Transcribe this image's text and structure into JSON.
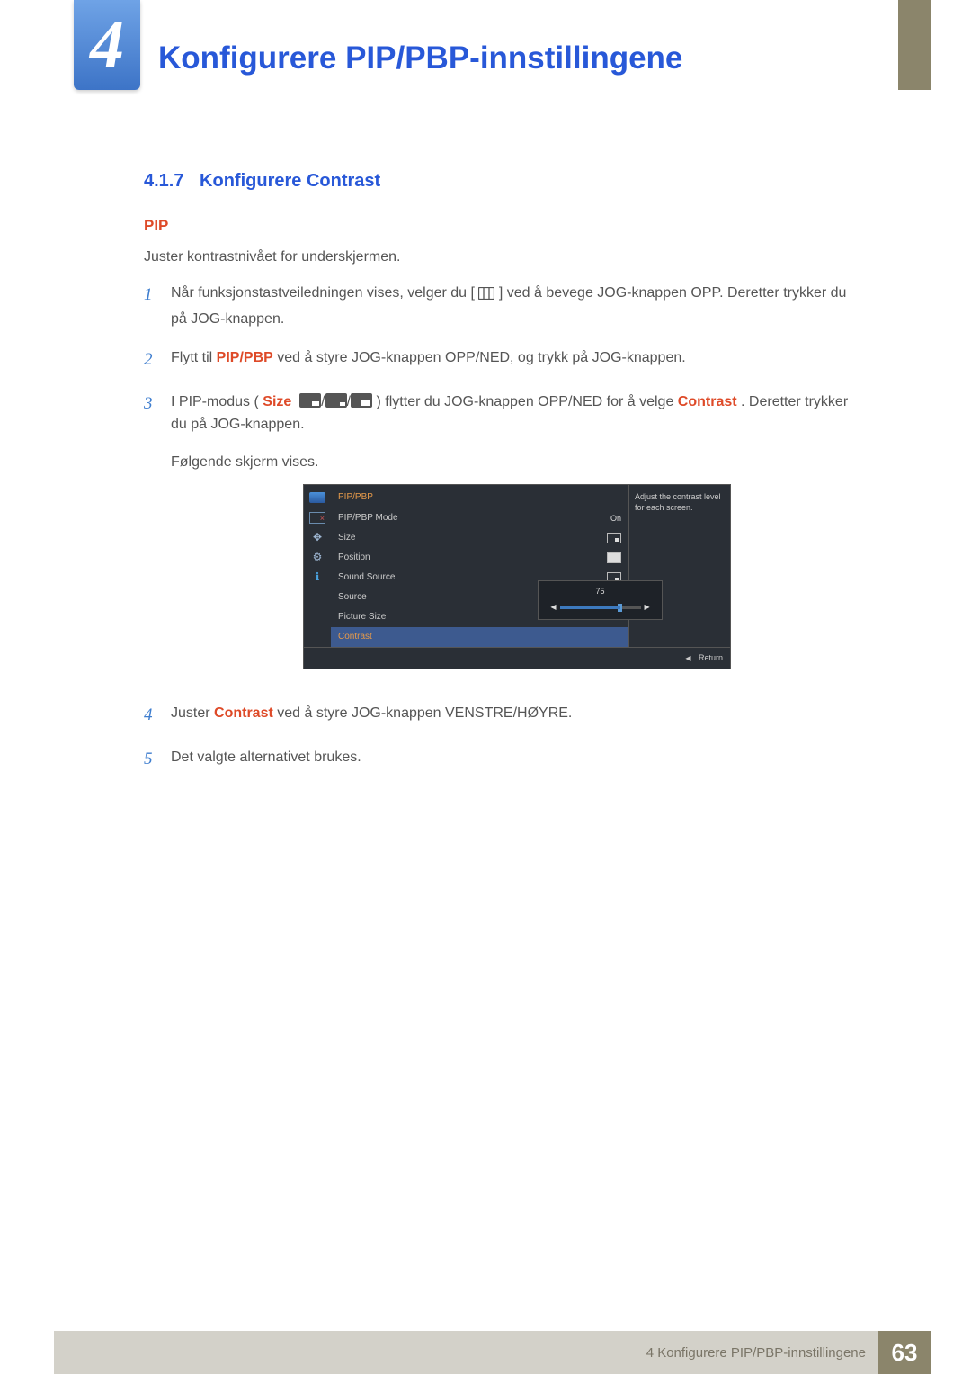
{
  "chapter": {
    "number": "4",
    "title": "Konfigurere PIP/PBP-innstillingene"
  },
  "section": {
    "number": "4.1.7",
    "title": "Konfigurere Contrast"
  },
  "subhead": "PIP",
  "intro": "Juster kontrastnivået for underskjermen.",
  "steps": {
    "s1a": "Når funksjonstastveiledningen vises, velger du [",
    "s1b": "] ved å bevege JOG-knappen OPP. Deretter trykker du på JOG-knappen.",
    "s2a": "Flytt til ",
    "s2_pip": "PIP/PBP",
    "s2b": " ved å styre JOG-knappen OPP/NED, og trykk på JOG-knappen.",
    "s3a": "I PIP-modus (",
    "s3_size": "Size",
    "s3b": ") flytter du JOG-knappen OPP/NED for å velge ",
    "s3_contrast": "Contrast",
    "s3c": ". Deretter trykker du på JOG-knappen.",
    "s3_follow": "Følgende skjerm vises.",
    "s4a": "Juster ",
    "s4_contrast": "Contrast",
    "s4b": " ved å styre JOG-knappen VENSTRE/HØYRE.",
    "s5": "Det valgte alternativet brukes."
  },
  "nums": {
    "n1": "1",
    "n2": "2",
    "n3": "3",
    "n4": "4",
    "n5": "5"
  },
  "osd": {
    "title": "PIP/PBP",
    "rows": {
      "mode": "PIP/PBP Mode",
      "mode_val": "On",
      "size": "Size",
      "position": "Position",
      "sound": "Sound Source",
      "source": "Source",
      "picsize": "Picture Size",
      "contrast": "Contrast"
    },
    "slider_value": "75",
    "help": "Adjust the contrast level for each screen.",
    "return": "Return"
  },
  "footer": {
    "text": "4 Konfigurere PIP/PBP-innstillingene",
    "page": "63"
  }
}
